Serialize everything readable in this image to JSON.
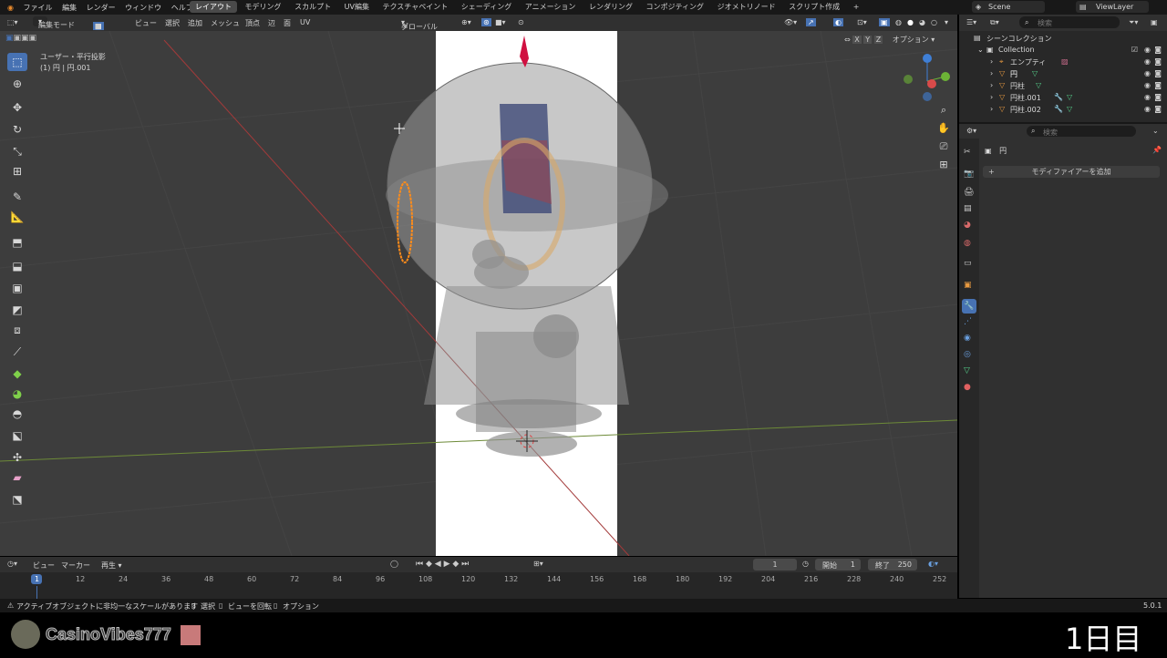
{
  "topbar": {
    "menu": [
      "ファイル",
      "編集",
      "レンダー",
      "ウィンドウ",
      "ヘルプ"
    ],
    "workspaces": [
      "レイアウト",
      "モデリング",
      "スカルプト",
      "UV編集",
      "テクスチャペイント",
      "シェーディング",
      "アニメーション",
      "レンダリング",
      "コンポジティング",
      "ジオメトリノード",
      "スクリプト作成"
    ],
    "add_ws": "+",
    "scene": "Scene",
    "viewlayer": "ViewLayer"
  },
  "viewport_header": {
    "mode": "編集モード",
    "menus": [
      "ビュー",
      "選択",
      "追加",
      "メッシュ",
      "頂点",
      "辺",
      "面",
      "UV"
    ],
    "transform": "グローバル",
    "axes": [
      "X",
      "Y",
      "Z"
    ],
    "options": "オプション"
  },
  "viewport": {
    "view_name": "ユーザー・平行投影",
    "object_info": "(1) 円 | 円.001"
  },
  "outliner": {
    "search_placeholder": "検索",
    "scene_collection": "シーンコレクション",
    "collection": "Collection",
    "items": [
      "エンプティ",
      "円",
      "円柱",
      "円柱.001",
      "円柱.002"
    ]
  },
  "properties": {
    "search_placeholder": "検索",
    "object_name": "円",
    "add_modifier": "モディファイアーを追加"
  },
  "timeline": {
    "menus": [
      "ビュー",
      "マーカー",
      "再生"
    ],
    "current_frame": "1",
    "start_label": "開始",
    "start": "1",
    "end_label": "終了",
    "end": "250",
    "ruler": [
      "1",
      "12",
      "24",
      "36",
      "48",
      "60",
      "72",
      "84",
      "96",
      "108",
      "120",
      "132",
      "144",
      "156",
      "168",
      "180",
      "192",
      "204",
      "216",
      "228",
      "240",
      "252"
    ]
  },
  "statusbar": {
    "warning": "アクティブオブジェクトに非均一なスケールがあります",
    "select": "選択",
    "rotate": "ビューを回転",
    "options": "オプション",
    "version": "5.0.1"
  },
  "overlay": {
    "username": "CasinoVibes777",
    "day": "1日目"
  }
}
